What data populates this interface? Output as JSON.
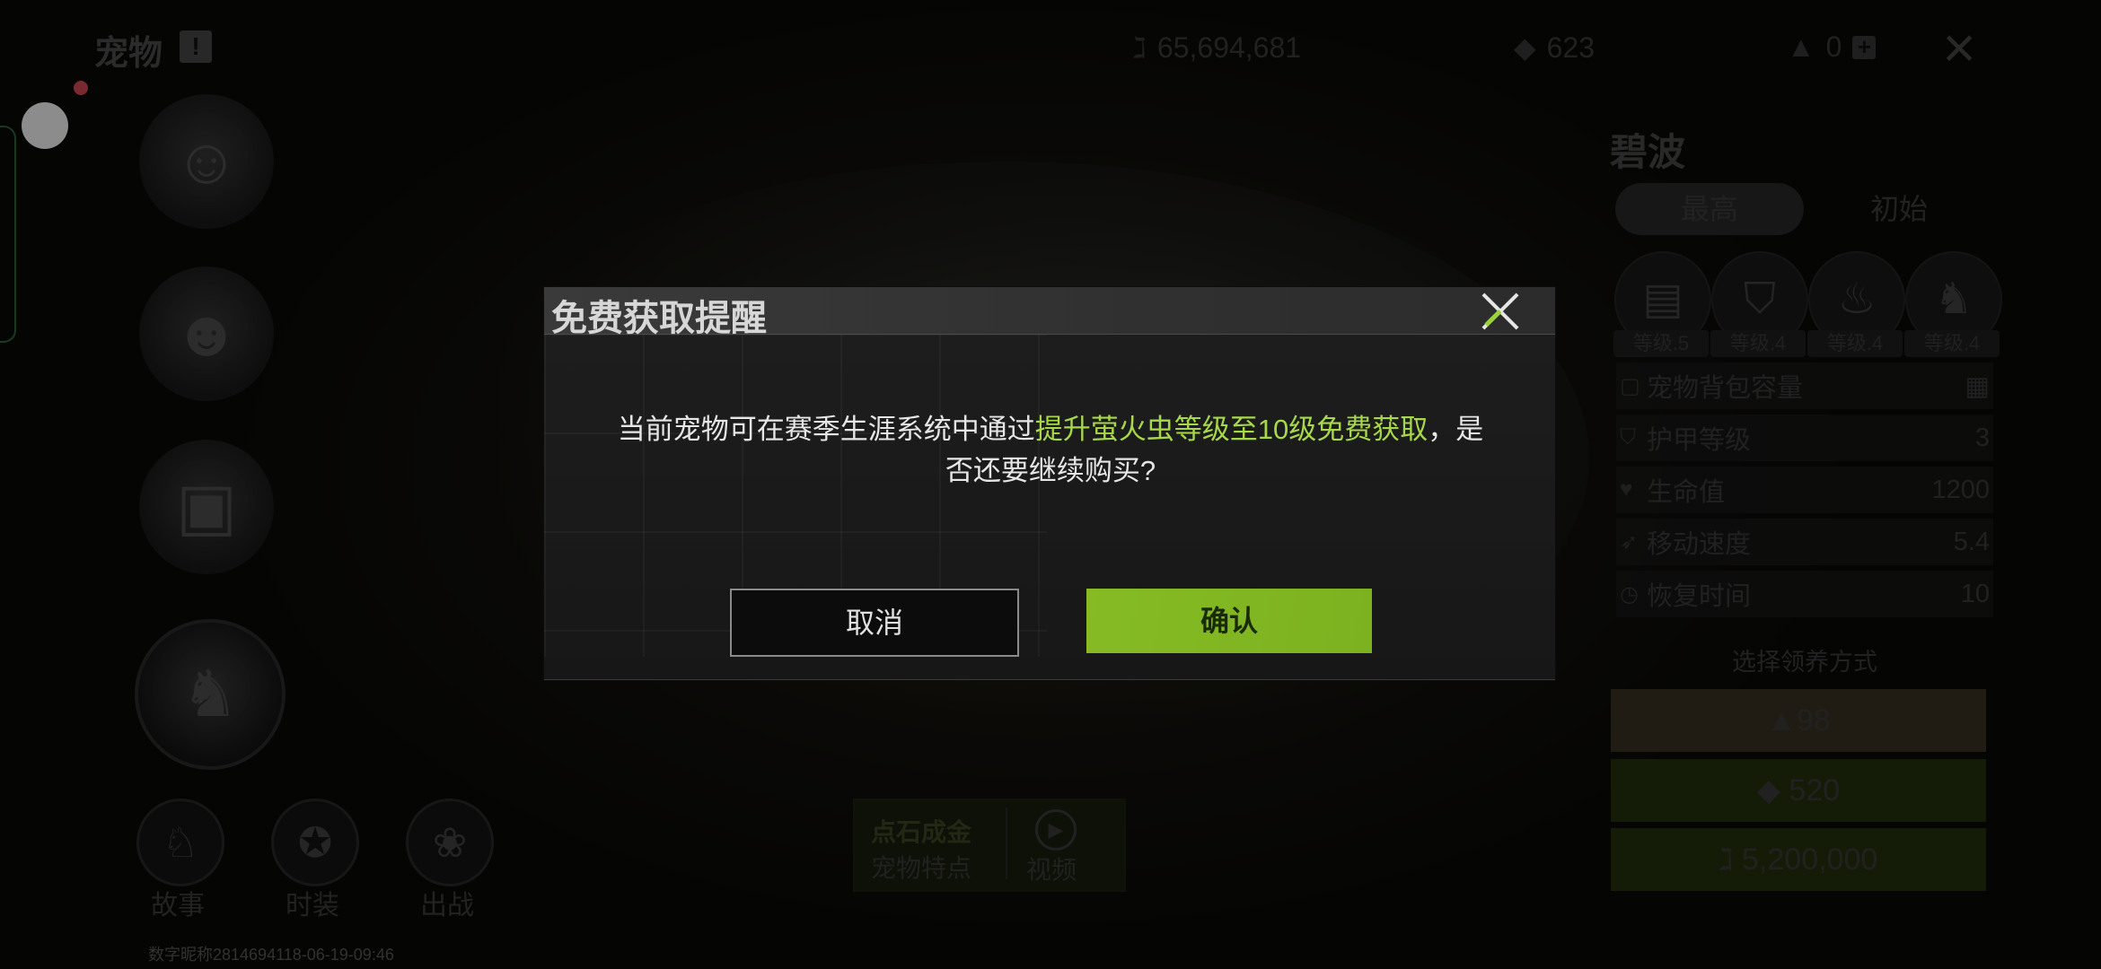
{
  "header": {
    "title": "宠物",
    "title_badge": "!",
    "coins": "65,694,681",
    "diamonds": "623",
    "tickets": "0",
    "plus_label": "+"
  },
  "pet_list": {
    "slots": [
      "pet-1",
      "pet-2",
      "pet-3",
      "pet-4-dragon"
    ]
  },
  "bottom_nav": {
    "story_label": "故事",
    "fashion_label": "时装",
    "deploy_label": "出战"
  },
  "watermark": "数字昵称2814694118-06-19-09:46",
  "center_action": {
    "stone_gold": "点石成金",
    "pet_features": "宠物特点",
    "video": "视频"
  },
  "right_panel": {
    "pet_name": "碧波",
    "tab_max": "最高",
    "tab_initial": "初始",
    "parts": [
      {
        "level": "等级.5"
      },
      {
        "level": "等级.4"
      },
      {
        "level": "等级.4"
      },
      {
        "level": "等级.4"
      }
    ],
    "stats": [
      {
        "name": "宠物背包容量",
        "value": ""
      },
      {
        "name": "护甲等级",
        "value": "3"
      },
      {
        "name": "生命值",
        "value": "1200"
      },
      {
        "name": "移动速度",
        "value": "5.4"
      },
      {
        "name": "恢复时间",
        "value": "10"
      }
    ],
    "claim_title": "选择领养方式",
    "claim_gold": "98",
    "claim_diamond": "520",
    "claim_coin": "5,200,000"
  },
  "dialog": {
    "title": "免费获取提醒",
    "msg_before": "当前宠物可在赛季生涯系统中通过",
    "msg_highlight": "提升萤火虫等级至10级免费获取",
    "msg_after": "，是否还要继续购买?",
    "cancel_label": "取消",
    "confirm_label": "确认"
  },
  "colors": {
    "accent_green": "#86bb24",
    "highlight_text": "#a7d84a"
  }
}
